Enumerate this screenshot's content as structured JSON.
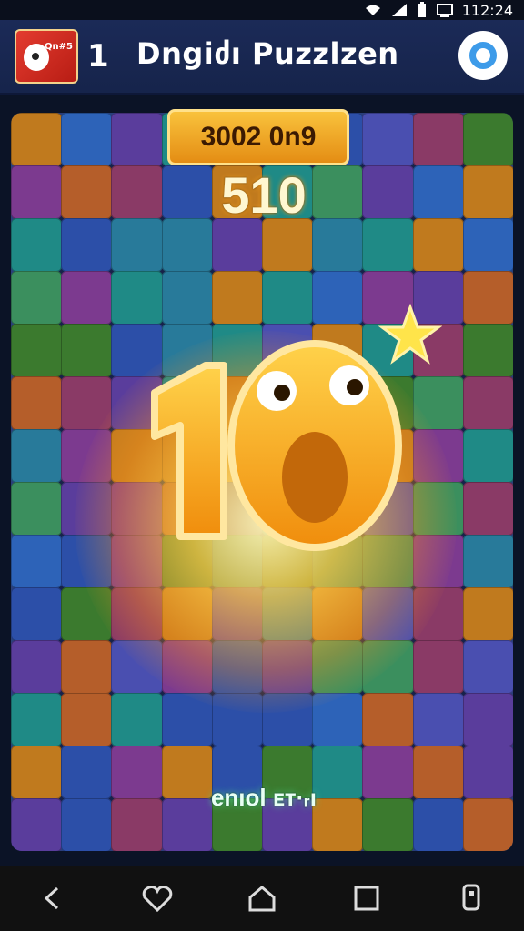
{
  "status_bar": {
    "time": "112:24",
    "icons": [
      "wifi-icon",
      "signal-icon",
      "battery-icon",
      "screen-icon"
    ]
  },
  "header": {
    "app_icon": {
      "label": "Qn#5",
      "name": "app-icon"
    },
    "count": "1",
    "title": "Dngiძı Puzzlzen",
    "help_icon": "help-icon"
  },
  "game": {
    "score_banner": "3002 0n9",
    "score_value": "510",
    "big_number": "10",
    "footer_text": "enıol ᴇᴛ·ᵣı"
  },
  "nav": {
    "icons": [
      "back-icon",
      "heart-icon",
      "home-icon",
      "recents-icon",
      "accessibility-icon"
    ]
  },
  "colors": {
    "accent": "#f4a020",
    "board": "#17224a",
    "app_bar": "#1b2a57"
  }
}
